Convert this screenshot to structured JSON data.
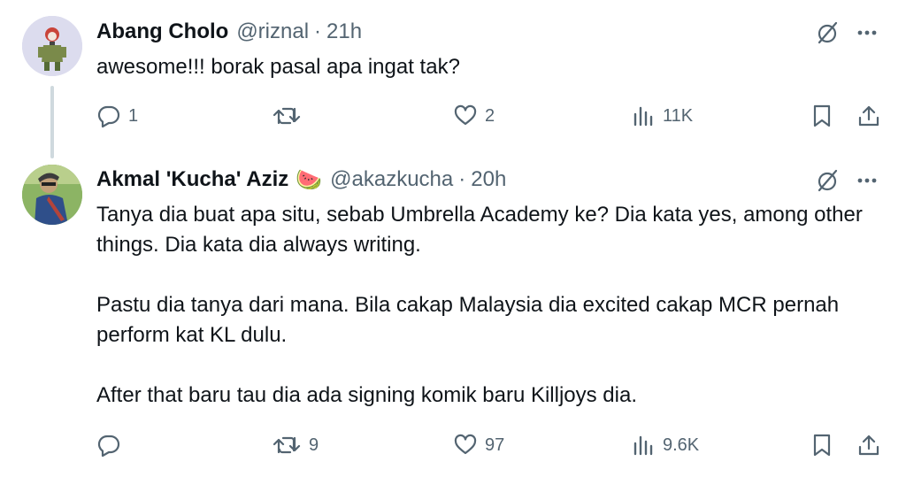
{
  "tweets": [
    {
      "author_name": "Abang Cholo",
      "author_emoji": "",
      "handle": "@riznal",
      "separator": "·",
      "time": "21h",
      "paragraphs": [
        "awesome!!! borak pasal apa ingat tak?"
      ],
      "replies": "1",
      "retweets": "",
      "likes": "2",
      "views": "11K",
      "icons": {
        "reply": "reply-icon",
        "retweet": "retweet-icon",
        "like": "heart-icon",
        "views": "views-icon",
        "bookmark": "bookmark-icon",
        "share": "share-icon",
        "grok": "grok-icon",
        "more": "more-icon"
      }
    },
    {
      "author_name": "Akmal 'Kucha' Aziz",
      "author_emoji": "🍉",
      "handle": "@akazkucha",
      "separator": "·",
      "time": "20h",
      "paragraphs": [
        "Tanya dia buat apa situ, sebab Umbrella Academy ke? Dia kata yes, among other things. Dia kata dia always writing.",
        "Pastu dia tanya dari mana. Bila cakap Malaysia dia excited cakap MCR pernah perform kat KL dulu.",
        "After that baru tau dia ada signing komik baru Killjoys dia."
      ],
      "replies": "",
      "retweets": "9",
      "likes": "97",
      "views": "9.6K",
      "icons": {
        "reply": "reply-icon",
        "retweet": "retweet-icon",
        "like": "heart-icon",
        "views": "views-icon",
        "bookmark": "bookmark-icon",
        "share": "share-icon",
        "grok": "grok-icon",
        "more": "more-icon"
      }
    }
  ],
  "colors": {
    "text": "#0f1419",
    "muted": "#536471",
    "thread_line": "#cfd9de"
  }
}
